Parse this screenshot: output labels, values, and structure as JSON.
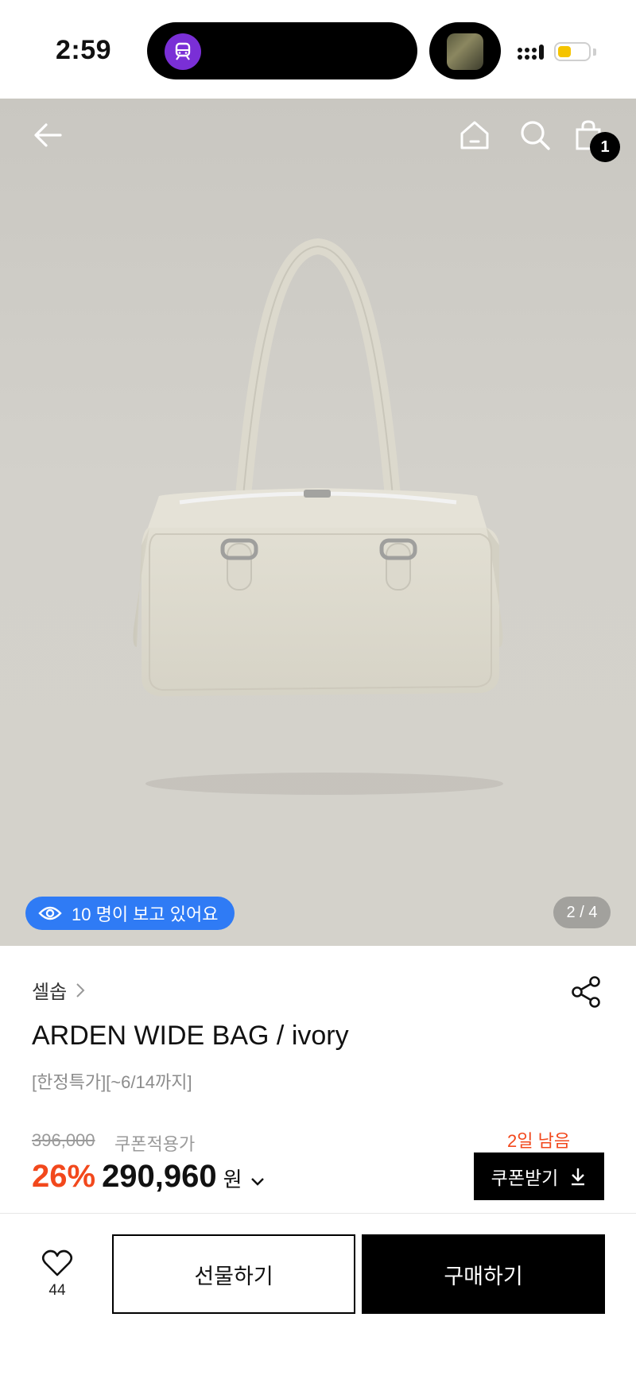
{
  "status_bar": {
    "time": "2:59",
    "icons": [
      "train-icon",
      "album-art",
      "signal-icon",
      "battery-icon"
    ],
    "battery_color": "#f5c400"
  },
  "hero": {
    "cart_count": "1",
    "viewers_text": "10 명이 보고 있어요",
    "page_indicator": "2 / 4",
    "viewers_color": "#2f7bf5"
  },
  "product": {
    "brand": "셀솝",
    "title": "ARDEN WIDE BAG / ivory",
    "subtitle": "[한정특가][~6/14까지]",
    "original_price": "396,000",
    "coupon_price_label": "쿠폰적용가",
    "discount": "26%",
    "sale_price": "290,960",
    "currency": "원",
    "days_left": "2일 남음",
    "coupon_button": "쿠폰받기",
    "accent_color": "#f2481c"
  },
  "bottom_bar": {
    "like_count": "44",
    "gift_label": "선물하기",
    "buy_label": "구매하기"
  }
}
